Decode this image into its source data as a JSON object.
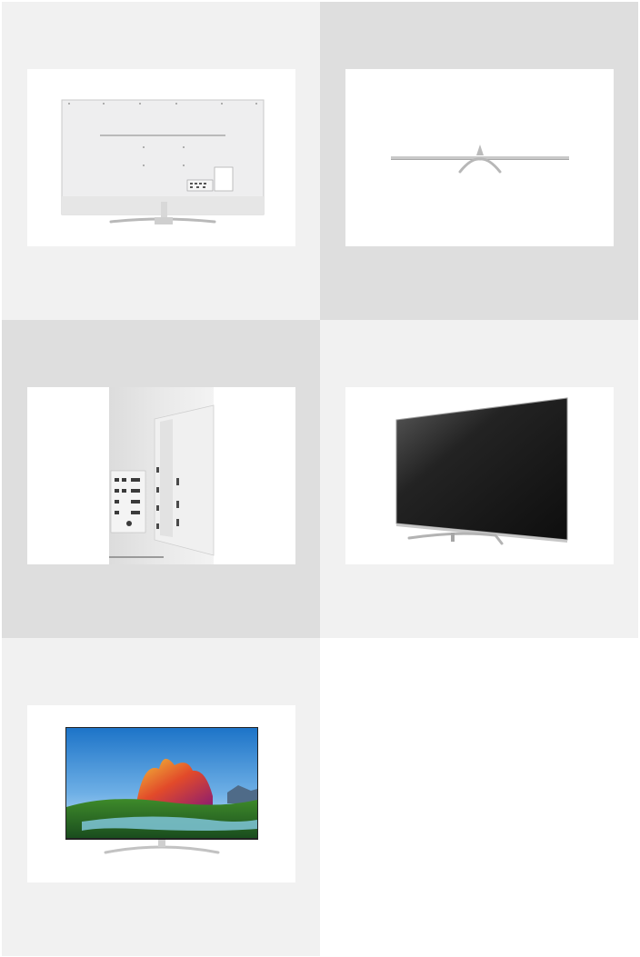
{
  "colors": {
    "tile_light": "#f1f1f1",
    "tile_dark": "#dedede",
    "tile_white": "#ffffff",
    "frame_bg": "#ffffff"
  },
  "gallery": {
    "thumbnails": [
      {
        "name": "tv-rear-view",
        "tile": "tile_light"
      },
      {
        "name": "tv-top-view",
        "tile": "tile_dark"
      },
      {
        "name": "tv-ports-closeup",
        "tile": "tile_dark"
      },
      {
        "name": "tv-angled-front-view",
        "tile": "tile_light"
      },
      {
        "name": "tv-front-view-screen-on",
        "tile": "tile_light"
      }
    ],
    "empty_slot": {
      "tile": "tile_white"
    }
  }
}
